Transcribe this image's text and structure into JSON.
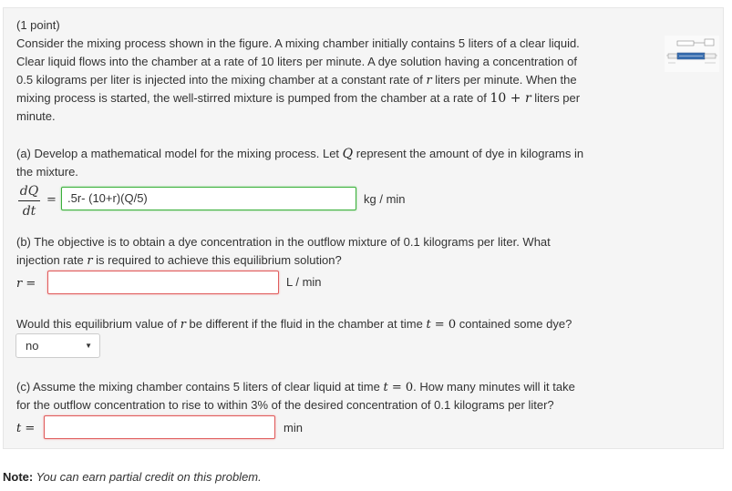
{
  "points": "(1 point)",
  "intro": {
    "line1": "Consider the mixing process shown in the figure. A mixing chamber initially contains 5 liters of a clear liquid.",
    "line2": "Clear liquid flows into the chamber at a rate of 10 liters per minute. A dye solution having a concentration of",
    "line3a": "0.5 kilograms per liter is injected into the mixing chamber at a constant rate of ",
    "line3var": "r",
    "line3b": " liters per minute. When the",
    "line4a": "mixing process is started, the well-stirred mixture is pumped from the chamber at a rate of ",
    "line4expr": "10 + ",
    "line4var": "r",
    "line4b": " liters per",
    "line5": "minute."
  },
  "part_a": {
    "text1a": "(a) Develop a mathematical model for the mixing process. Let ",
    "text1var": "Q",
    "text1b": " represent the amount of dye in kilograms in",
    "text2": "the mixture.",
    "frac_num": "dQ",
    "frac_den": "dt",
    "equals": "=",
    "answer": ".5r- (10+r)(Q/5)",
    "unit": "kg / min"
  },
  "part_b": {
    "text1": "(b) The objective is to obtain a dye concentration in the outflow mixture of 0.1 kilograms per liter. What",
    "text2a": "injection rate ",
    "text2var": "r",
    "text2b": " is required to achieve this equilibrium solution?",
    "label_var": "r",
    "label_eq": " =",
    "answer": "",
    "unit": "L / min"
  },
  "question_dye": {
    "text_a": "Would this equilibrium value of ",
    "text_var": "r",
    "text_b": " be different if the fluid in the chamber at time ",
    "text_t": "t",
    "text_eq": " = 0",
    "text_c": " contained some dye?",
    "select_value": "no"
  },
  "part_c": {
    "text1a": "(c) Assume the mixing chamber contains 5 liters of clear liquid at time ",
    "text1t": "t",
    "text1eq": " = 0",
    "text1b": ". How many minutes will it take",
    "text2": "for the outflow concentration to rise to within 3% of the desired concentration of 0.1 kilograms per liter?",
    "label_var": "t",
    "label_eq": " =",
    "answer": "",
    "unit": "min"
  },
  "note": {
    "label": "Note:",
    "text": " You can earn partial credit on this problem."
  }
}
